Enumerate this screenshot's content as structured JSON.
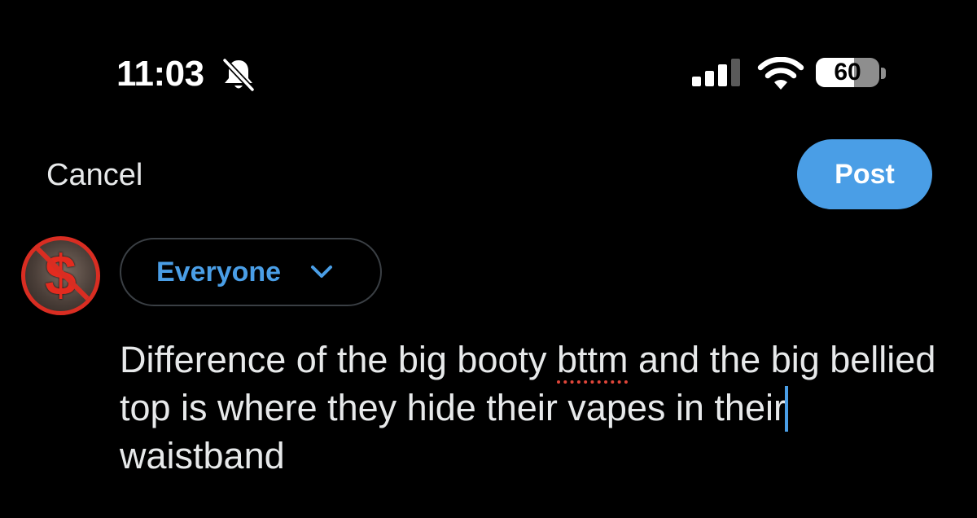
{
  "status_bar": {
    "time": "11:03",
    "battery_level": 60,
    "battery_label": "60",
    "mute_icon": "bell-slash-icon",
    "signal_icon": "cellular-signal-icon",
    "wifi_icon": "wifi-icon"
  },
  "header": {
    "cancel_label": "Cancel",
    "post_label": "Post"
  },
  "avatar": {
    "symbol": "$",
    "border_color": "#d92d22"
  },
  "audience": {
    "label": "Everyone",
    "icon": "chevron-down-icon"
  },
  "composer": {
    "text_part1": "Difference of the big booty ",
    "misspelled_word": "bttm",
    "text_part2": " and the big bellied top is where they hide their vapes in their",
    "text_part3": " waistband"
  },
  "colors": {
    "accent": "#4a9ee6",
    "background": "#000000",
    "text": "#e7e9ea",
    "spellcheck": "#e0463a"
  }
}
